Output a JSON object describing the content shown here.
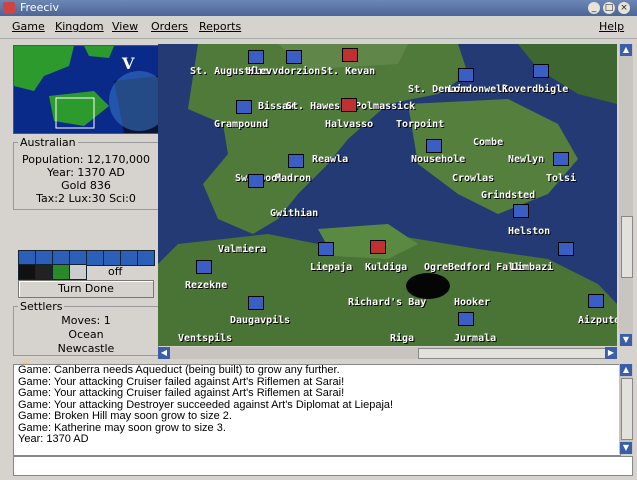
{
  "window": {
    "title": "Freeciv"
  },
  "menu": [
    "Game",
    "Kingdom",
    "View",
    "Orders",
    "Reports",
    "Help"
  ],
  "overview": {
    "label": "V"
  },
  "player": {
    "nation": "Australian",
    "population": "Population: 12,170,000",
    "year": "Year: 1370 AD",
    "gold": "Gold 836",
    "tax": "Tax:2 Lux:30 Sci:0"
  },
  "timeout": {
    "label": "off"
  },
  "turn_done": "Turn Done",
  "unit": {
    "group": "Settlers",
    "moves": "Moves: 1",
    "terrain": "Ocean",
    "city": "Newcastle"
  },
  "cities": [
    "St. Augustine",
    "Hlevvdorzion",
    "St. Kevan",
    "St. Dennis",
    "Londonwell",
    "Koverdbigle",
    "Bissau",
    "St. Hawes",
    "Polmassick",
    "Grampound",
    "Halvasso",
    "Torpoint",
    "Combe",
    "Reawla",
    "Nousehole",
    "Newlyn",
    "Swanpool",
    "Madron",
    "Crowlas",
    "Tolsi",
    "Grindsted",
    "Gwithian",
    "Helston",
    "Valmiera",
    "Liepaja",
    "Kuldiga",
    "Ogre",
    "Bedford Falls",
    "Limbazi",
    "Rezekne",
    "Richard's Bay",
    "Hooker",
    "Daugavpils",
    "Aizpute",
    "Ventspils",
    "Riga",
    "Jurmala"
  ],
  "messages": [
    "Game: Canberra needs Aqueduct (being built) to grow any further.",
    "Game: Your attacking Cruiser failed against Art's Riflemen at Sarai!",
    "Game: Your attacking Cruiser failed against Art's Riflemen at Sarai!",
    "Game: Your attacking Destroyer succeeded against Art's Diplomat at Liepaja!",
    "Game: Broken Hill may soon grow to size 2.",
    "Game: Katherine may soon grow to size 3.",
    "Year: 1370 AD"
  ],
  "colors": {
    "ocean": "#233a75",
    "land": "#4f7a3a",
    "titlebar": "#4a6597"
  }
}
